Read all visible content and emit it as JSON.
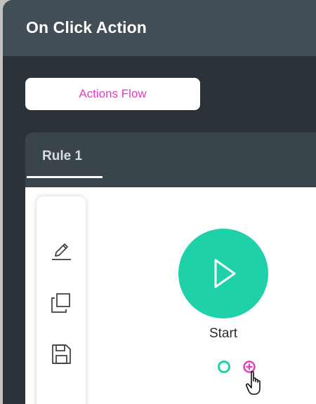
{
  "window": {
    "title": "On Click Action"
  },
  "flow_button": {
    "label": "Actions Flow"
  },
  "tabs": [
    {
      "label": "Rule 1",
      "active": true
    }
  ],
  "toolbar": {
    "tools": [
      {
        "icon": "pencil-icon"
      },
      {
        "icon": "copy-icon"
      },
      {
        "icon": "save-icon"
      }
    ]
  },
  "start_node": {
    "label": "Start",
    "icon": "play-icon"
  },
  "colors": {
    "title_bar": "#424e55",
    "window_bg": "#2b3338",
    "panel_bg": "#3a454b",
    "accent_pink": "#e040c0",
    "start_green": "#1fd1a9"
  }
}
